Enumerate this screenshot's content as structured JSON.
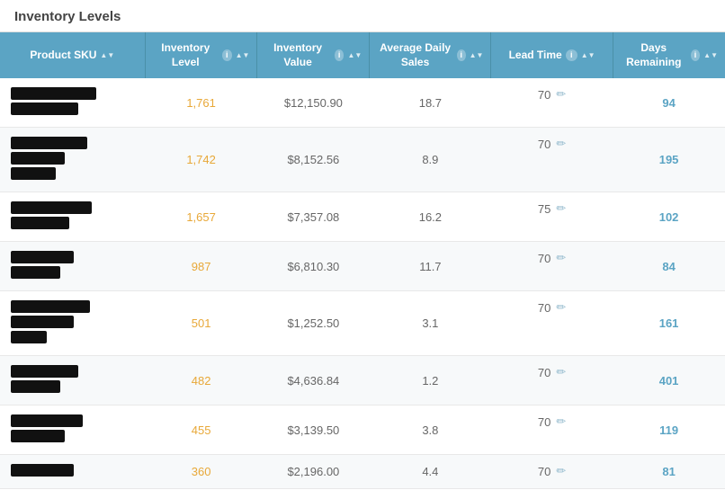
{
  "title": "Inventory Levels",
  "columns": [
    {
      "key": "sku",
      "label": "Product SKU",
      "sortable": true,
      "info": false
    },
    {
      "key": "inv_level",
      "label": "Inventory Level",
      "sortable": true,
      "info": true
    },
    {
      "key": "inv_value",
      "label": "Inventory Value",
      "sortable": true,
      "info": true
    },
    {
      "key": "avg_sales",
      "label": "Average Daily Sales",
      "sortable": true,
      "info": true
    },
    {
      "key": "lead_time",
      "label": "Lead Time",
      "sortable": true,
      "info": true
    },
    {
      "key": "days_remaining",
      "label": "Days Remaining",
      "sortable": true,
      "info": true
    }
  ],
  "rows": [
    {
      "inv_level": "1,761",
      "inv_value": "$12,150.90",
      "avg_sales": "18.7",
      "lead_time": "70",
      "days_remaining": "94"
    },
    {
      "inv_level": "1,742",
      "inv_value": "$8,152.56",
      "avg_sales": "8.9",
      "lead_time": "70",
      "days_remaining": "195"
    },
    {
      "inv_level": "1,657",
      "inv_value": "$7,357.08",
      "avg_sales": "16.2",
      "lead_time": "75",
      "days_remaining": "102"
    },
    {
      "inv_level": "987",
      "inv_value": "$6,810.30",
      "avg_sales": "11.7",
      "lead_time": "70",
      "days_remaining": "84"
    },
    {
      "inv_level": "501",
      "inv_value": "$1,252.50",
      "avg_sales": "3.1",
      "lead_time": "70",
      "days_remaining": "161"
    },
    {
      "inv_level": "482",
      "inv_value": "$4,636.84",
      "avg_sales": "1.2",
      "lead_time": "70",
      "days_remaining": "401"
    },
    {
      "inv_level": "455",
      "inv_value": "$3,139.50",
      "avg_sales": "3.8",
      "lead_time": "70",
      "days_remaining": "119"
    },
    {
      "inv_level": "360",
      "inv_value": "$2,196.00",
      "avg_sales": "4.4",
      "lead_time": "70",
      "days_remaining": "81"
    }
  ],
  "sku_blocks": [
    [
      {
        "w": 95
      },
      {
        "w": 75
      }
    ],
    [
      {
        "w": 85
      },
      {
        "w": 60
      },
      {
        "w": 50
      }
    ],
    [
      {
        "w": 90
      },
      {
        "w": 65
      }
    ],
    [
      {
        "w": 70
      },
      {
        "w": 55
      }
    ],
    [
      {
        "w": 88
      },
      {
        "w": 70
      },
      {
        "w": 40
      }
    ],
    [
      {
        "w": 75
      },
      {
        "w": 55
      }
    ],
    [
      {
        "w": 80
      },
      {
        "w": 60
      }
    ],
    [
      {
        "w": 70
      }
    ]
  ]
}
